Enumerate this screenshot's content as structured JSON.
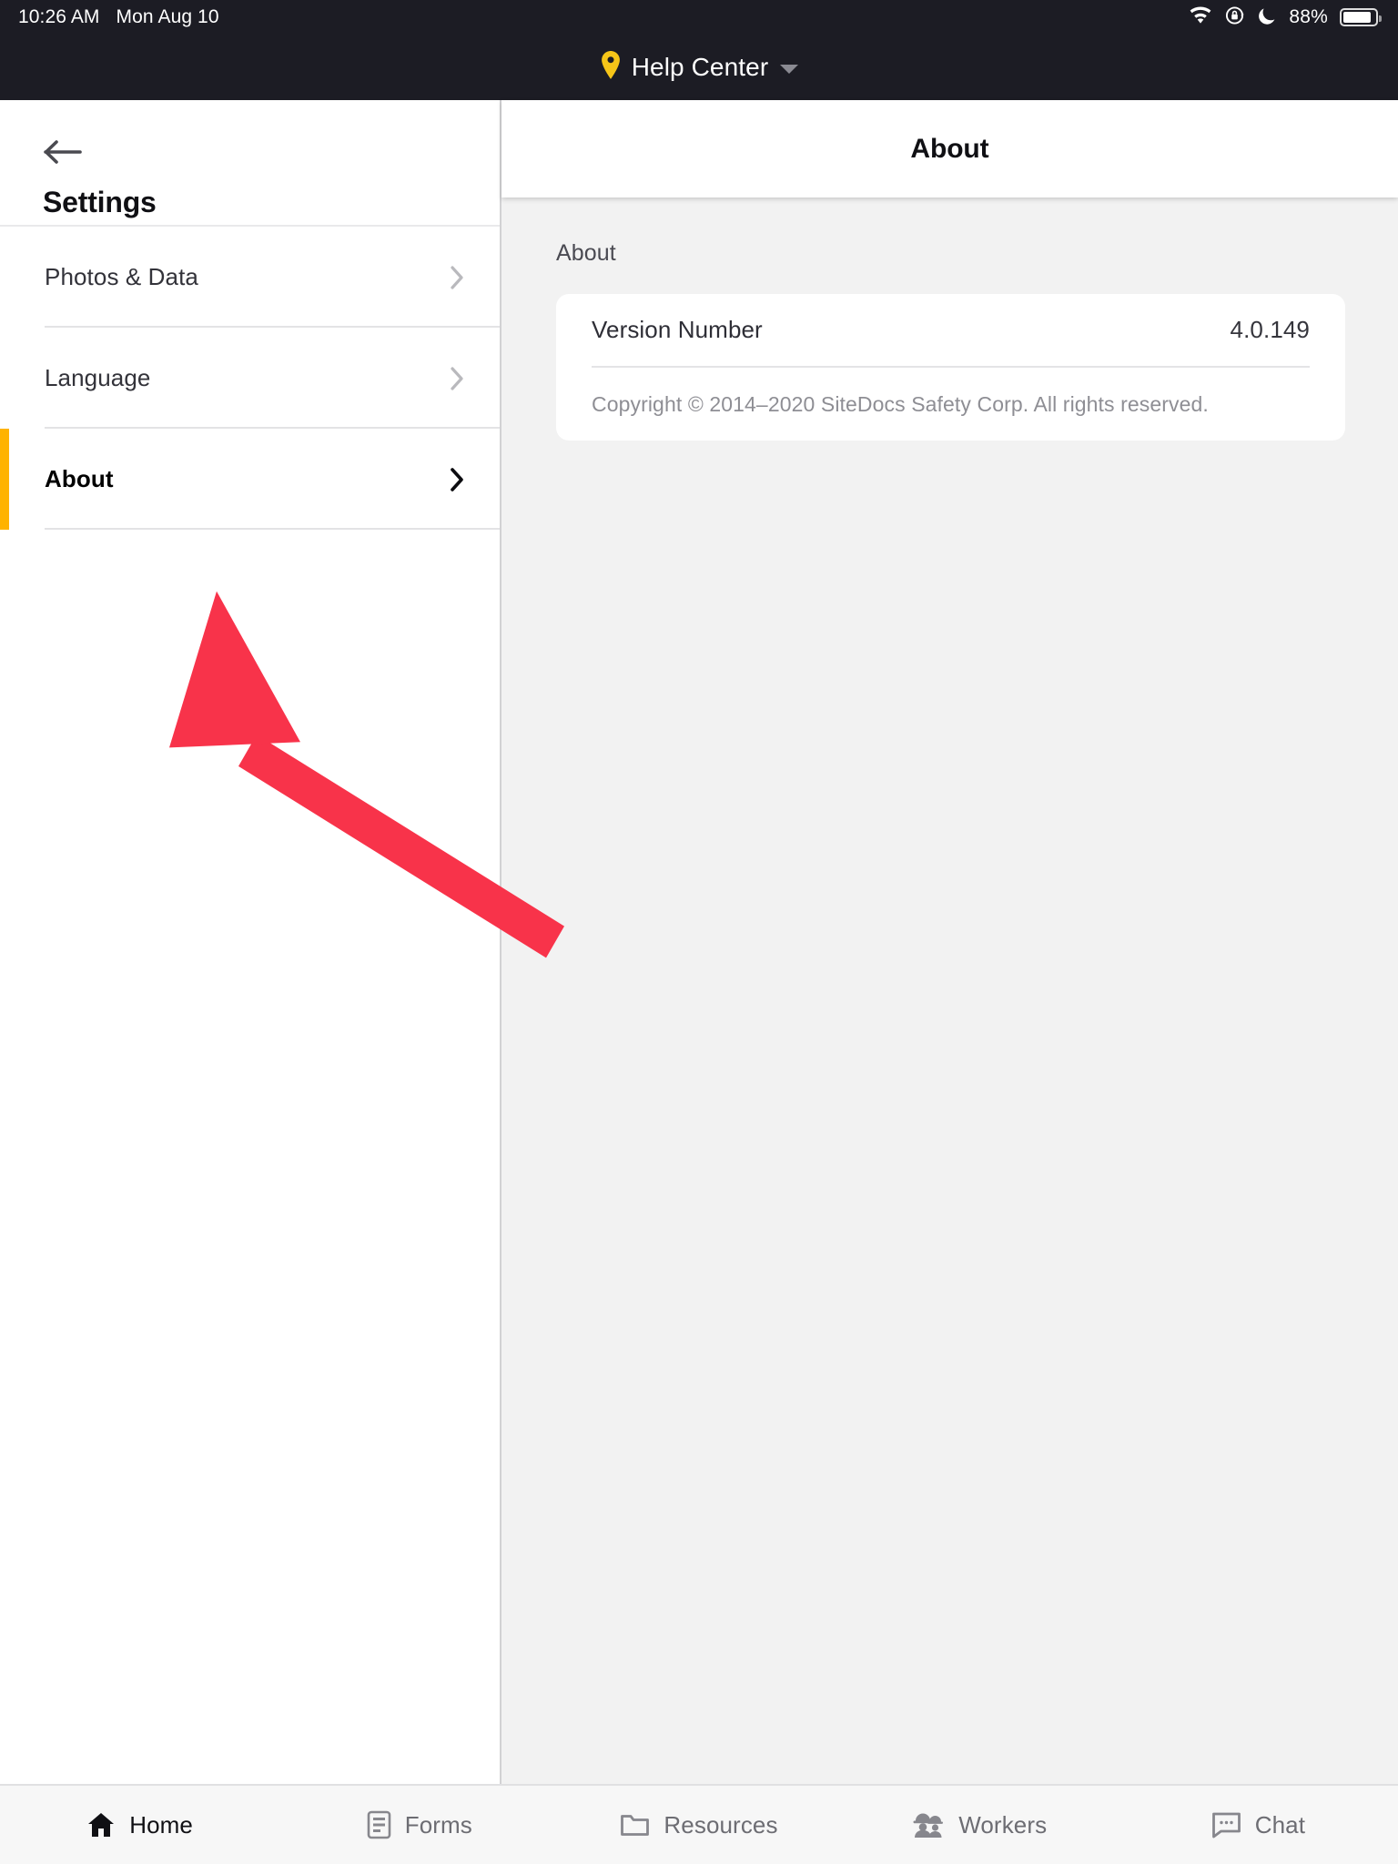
{
  "statusbar": {
    "time": "10:26 AM",
    "date": "Mon Aug 10",
    "battery_percent": "88%",
    "icons": [
      "wifi-icon",
      "rotation-lock-icon",
      "do-not-disturb-moon-icon",
      "battery-icon"
    ]
  },
  "navbar": {
    "location_label": "Help Center",
    "pin_icon": "location-pin-icon",
    "pin_color": "#f6c518",
    "chevron_icon": "chevron-down-icon"
  },
  "sidebar": {
    "back_icon": "back-arrow-icon",
    "title": "Settings",
    "accent_color": "#ffb300",
    "items": [
      {
        "label": "Photos & Data",
        "selected": false,
        "chevron": "chevron-right-icon"
      },
      {
        "label": "Language",
        "selected": false,
        "chevron": "chevron-right-icon"
      },
      {
        "label": "About",
        "selected": true,
        "chevron": "chevron-right-icon"
      }
    ]
  },
  "detail": {
    "header_title": "About",
    "section_label": "About",
    "rows": [
      {
        "key": "Version Number",
        "value": "4.0.149"
      }
    ],
    "footer": "Copyright © 2014–2020 SiteDocs Safety Corp. All rights reserved."
  },
  "annotation": {
    "type": "arrow",
    "color": "#f8334a",
    "points_to": "sidebar-item-about"
  },
  "tabbar": {
    "tabs": [
      {
        "label": "Home",
        "icon": "home-icon",
        "active": true
      },
      {
        "label": "Forms",
        "icon": "document-list-icon",
        "active": false
      },
      {
        "label": "Resources",
        "icon": "folder-icon",
        "active": false
      },
      {
        "label": "Workers",
        "icon": "workers-hardhat-icon",
        "active": false
      },
      {
        "label": "Chat",
        "icon": "chat-bubble-icon",
        "active": false
      }
    ]
  }
}
